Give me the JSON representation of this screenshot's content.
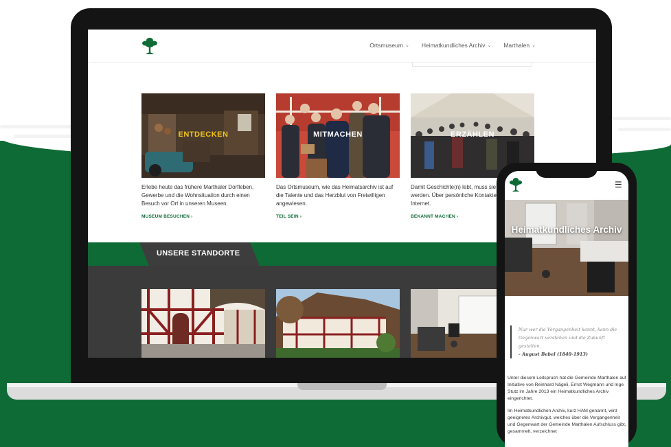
{
  "nav": {
    "items": [
      {
        "label": "Ortsmuseum"
      },
      {
        "label": "Heimatkundliches Archiv"
      },
      {
        "label": "Marthalen"
      }
    ]
  },
  "cards": [
    {
      "title": "ENTDECKEN",
      "text": "Erlebe heute das frühere Marthaler Dorfleben, Gewerbe und die Wohnsituation durch einen Besuch vor Ort in unseren Museen.",
      "link": "MUSEUM BESUCHEN ›"
    },
    {
      "title": "MITMACHEN",
      "text": "Das Ortsmuseum, wie das Heimatsarchiv ist auf die Talente und das Herzblut von Freiwilligen angewiesen.",
      "link": "TEIL SEIN ›"
    },
    {
      "title": "ERZÄHLEN",
      "text": "Damit Geschichte(n) lebt, muss sie weitererzählt werden. Über persönliche Kontakte wie auch im Internet.",
      "link": "BEKANNT MACHEN ›"
    }
  ],
  "section": {
    "title": "UNSERE STANDORTE"
  },
  "phone": {
    "hero_title": "Heimatkundliches Archiv",
    "quote": "Nur wer die Vergangenheit kennt, kann die Gegenwart verstehen und die Zukunft gestalten.",
    "quote_author": "- August Bebel (1840-1913)",
    "body_1": "Unter diesem Leitspruch hat die Gemeinde Marthalen auf Initiative von Reinhard Nägeli, Ernst Wegmann und Inge Stutz im Jahre 2013 ein Heimatkundliches Archiv eingerichtet.",
    "body_2": "Im Heimatkundlichen Archiv, kurz HAM genannt, wird geeignetes Archivgut, welches über die Vergangenheit und Gegenwart der Gemeinde Marthalen Aufschluss gibt, gesammelt, verzeichnet"
  },
  "colors": {
    "brand_green": "#0f6b36",
    "title_yellow": "#f0c419",
    "dark_band": "#3b3b3b"
  },
  "icons": {
    "logo": "tree-icon",
    "menu": "hamburger-icon",
    "chevron": "chevron-down-icon"
  }
}
